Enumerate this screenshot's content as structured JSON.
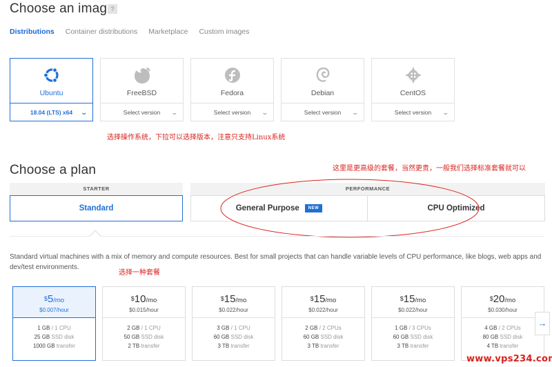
{
  "image_section": {
    "title": "Choose an image",
    "help": "?",
    "tabs": [
      {
        "label": "Distributions",
        "active": true
      },
      {
        "label": "Container distributions",
        "active": false
      },
      {
        "label": "Marketplace",
        "active": false
      },
      {
        "label": "Custom images",
        "active": false
      }
    ],
    "distros": [
      {
        "name": "Ubuntu",
        "version": "18.04 (LTS) x64",
        "icon": "ubuntu-icon",
        "active": true
      },
      {
        "name": "FreeBSD",
        "version": "Select version",
        "icon": "freebsd-icon",
        "active": false
      },
      {
        "name": "Fedora",
        "version": "Select version",
        "icon": "fedora-icon",
        "active": false
      },
      {
        "name": "Debian",
        "version": "Select version",
        "icon": "debian-icon",
        "active": false
      },
      {
        "name": "CentOS",
        "version": "Select version",
        "icon": "centos-icon",
        "active": false
      }
    ],
    "annotation": "选择操作系统，下拉可以选择版本，注意只支持Linux系统"
  },
  "plan_section": {
    "title": "Choose a plan",
    "annotation": "这里是更高级的套餐，当然更贵，一般我们选择标准套餐就可以",
    "groups": {
      "starter": "STARTER",
      "performance": "PERFORMANCE"
    },
    "plans": {
      "standard": "Standard",
      "general_purpose": "General Purpose",
      "new_badge": "NEW",
      "cpu_optimized": "CPU Optimized"
    },
    "description": "Standard virtual machines with a mix of memory and compute resources. Best for small projects that can handle variable levels of CPU performance, like blogs, web apps and dev/test environments.",
    "pick_note": "选择一种套餐",
    "price_cards": [
      {
        "currency": "$",
        "amount": "5",
        "per": "/mo",
        "hourly": "$0.007/hour",
        "mem": "1 GB",
        "cpu": "/ 1 CPU",
        "disk": "25 GB",
        "disk_unit": "SSD disk",
        "transfer": "1000 GB",
        "transfer_unit": "transfer",
        "active": true
      },
      {
        "currency": "$",
        "amount": "10",
        "per": "/mo",
        "hourly": "$0.015/hour",
        "mem": "2 GB",
        "cpu": "/ 1 CPU",
        "disk": "50 GB",
        "disk_unit": "SSD disk",
        "transfer": "2 TB",
        "transfer_unit": "transfer",
        "active": false
      },
      {
        "currency": "$",
        "amount": "15",
        "per": "/mo",
        "hourly": "$0.022/hour",
        "mem": "3 GB",
        "cpu": "/ 1 CPU",
        "disk": "60 GB",
        "disk_unit": "SSD disk",
        "transfer": "3 TB",
        "transfer_unit": "transfer",
        "active": false
      },
      {
        "currency": "$",
        "amount": "15",
        "per": "/mo",
        "hourly": "$0.022/hour",
        "mem": "2 GB",
        "cpu": "/ 2 CPUs",
        "disk": "60 GB",
        "disk_unit": "SSD disk",
        "transfer": "3 TB",
        "transfer_unit": "transfer",
        "active": false
      },
      {
        "currency": "$",
        "amount": "15",
        "per": "/mo",
        "hourly": "$0.022/hour",
        "mem": "1 GB",
        "cpu": "/ 3 CPUs",
        "disk": "60 GB",
        "disk_unit": "SSD disk",
        "transfer": "3 TB",
        "transfer_unit": "transfer",
        "active": false
      },
      {
        "currency": "$",
        "amount": "20",
        "per": "/mo",
        "hourly": "$0.030/hour",
        "mem": "4 GB",
        "cpu": "/ 2 CPUs",
        "disk": "80 GB",
        "disk_unit": "SSD disk",
        "transfer": "4 TB",
        "transfer_unit": "transfer",
        "active": false
      }
    ],
    "next_arrow": "→"
  },
  "watermark": "www.vps234.com",
  "colors": {
    "accent": "#1f6fd6",
    "annotation_red": "#d9221e",
    "selected_bg": "#eaf3fd"
  }
}
